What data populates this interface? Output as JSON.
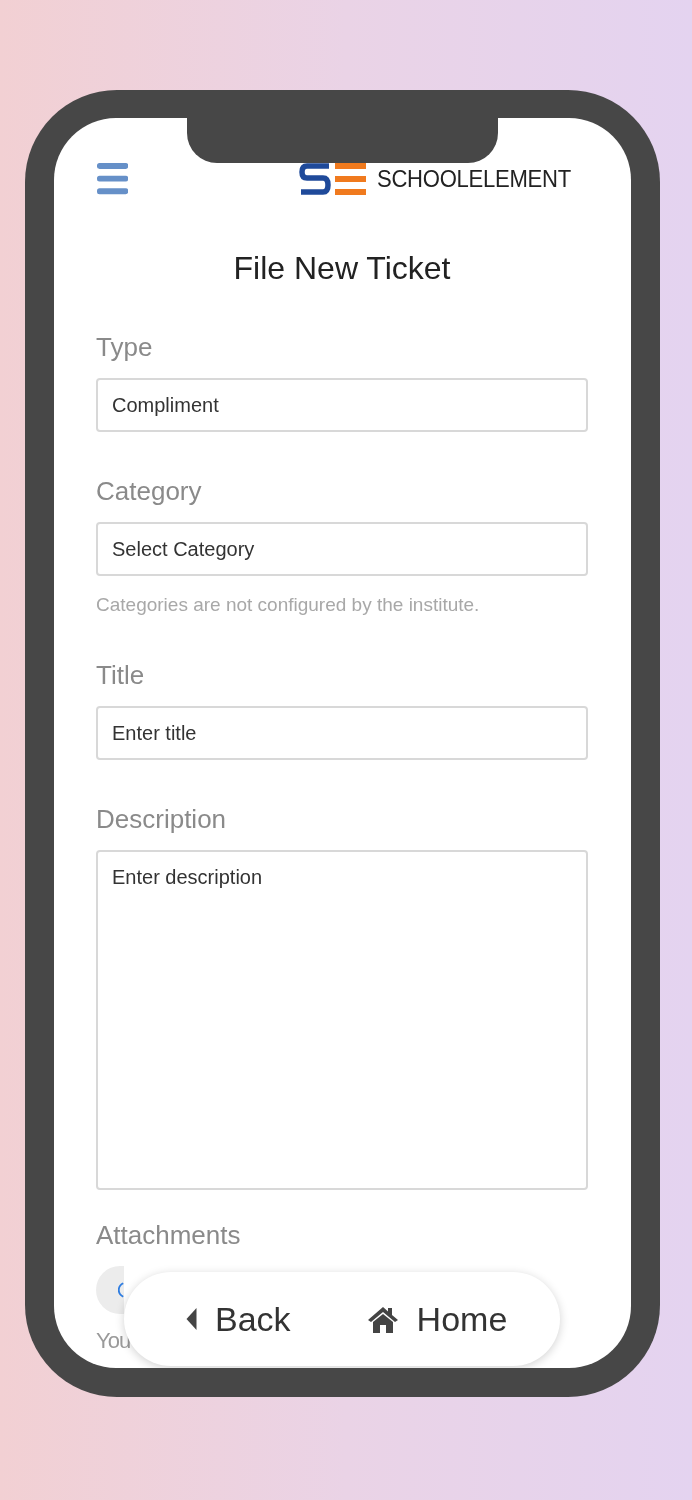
{
  "header": {
    "brand": "SCHOOLELEMENT"
  },
  "title": "File New Ticket",
  "fields": [
    {
      "label": "Type",
      "kind": "select",
      "value": "Compliment"
    },
    {
      "label": "Category",
      "kind": "select",
      "value": "Select Category",
      "help": "Categories are not configured by the institute."
    },
    {
      "label": "Title",
      "kind": "text",
      "placeholder": "Enter title"
    },
    {
      "label": "Description",
      "kind": "textarea",
      "placeholder": "Enter description"
    }
  ],
  "attachments": {
    "label": "Attachments",
    "note": "You"
  },
  "nav": [
    {
      "kind": "back",
      "label": "Back"
    },
    {
      "kind": "home",
      "label": "Home"
    }
  ]
}
